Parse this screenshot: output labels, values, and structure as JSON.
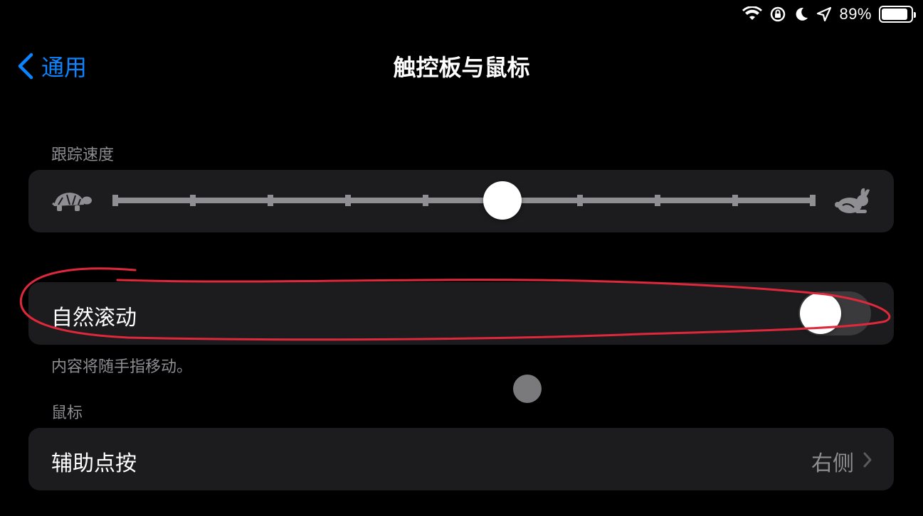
{
  "status_bar": {
    "battery_percent": "89%",
    "battery_level": 0.89,
    "icons": [
      "wifi-icon",
      "rotation-lock-icon",
      "do-not-disturb-moon-icon",
      "location-arrow-icon",
      "battery-icon"
    ]
  },
  "nav": {
    "back_label": "通用",
    "title": "触控板与鼠标"
  },
  "tracking": {
    "header": "跟踪速度",
    "tick_count": 10,
    "slider_value_index": 5,
    "slow_icon": "turtle-icon",
    "fast_icon": "rabbit-icon"
  },
  "natural_scroll": {
    "label": "自然滚动",
    "enabled": false,
    "footnote": "内容将随手指移动。"
  },
  "mouse": {
    "header": "鼠标",
    "secondary_click_label": "辅助点按",
    "secondary_click_value": "右侧"
  },
  "colors": {
    "accent": "#0a84ff",
    "background": "#000000",
    "group_background": "#1c1c1e",
    "secondary_text": "#8d8d92",
    "annotation": "#e0283c"
  }
}
